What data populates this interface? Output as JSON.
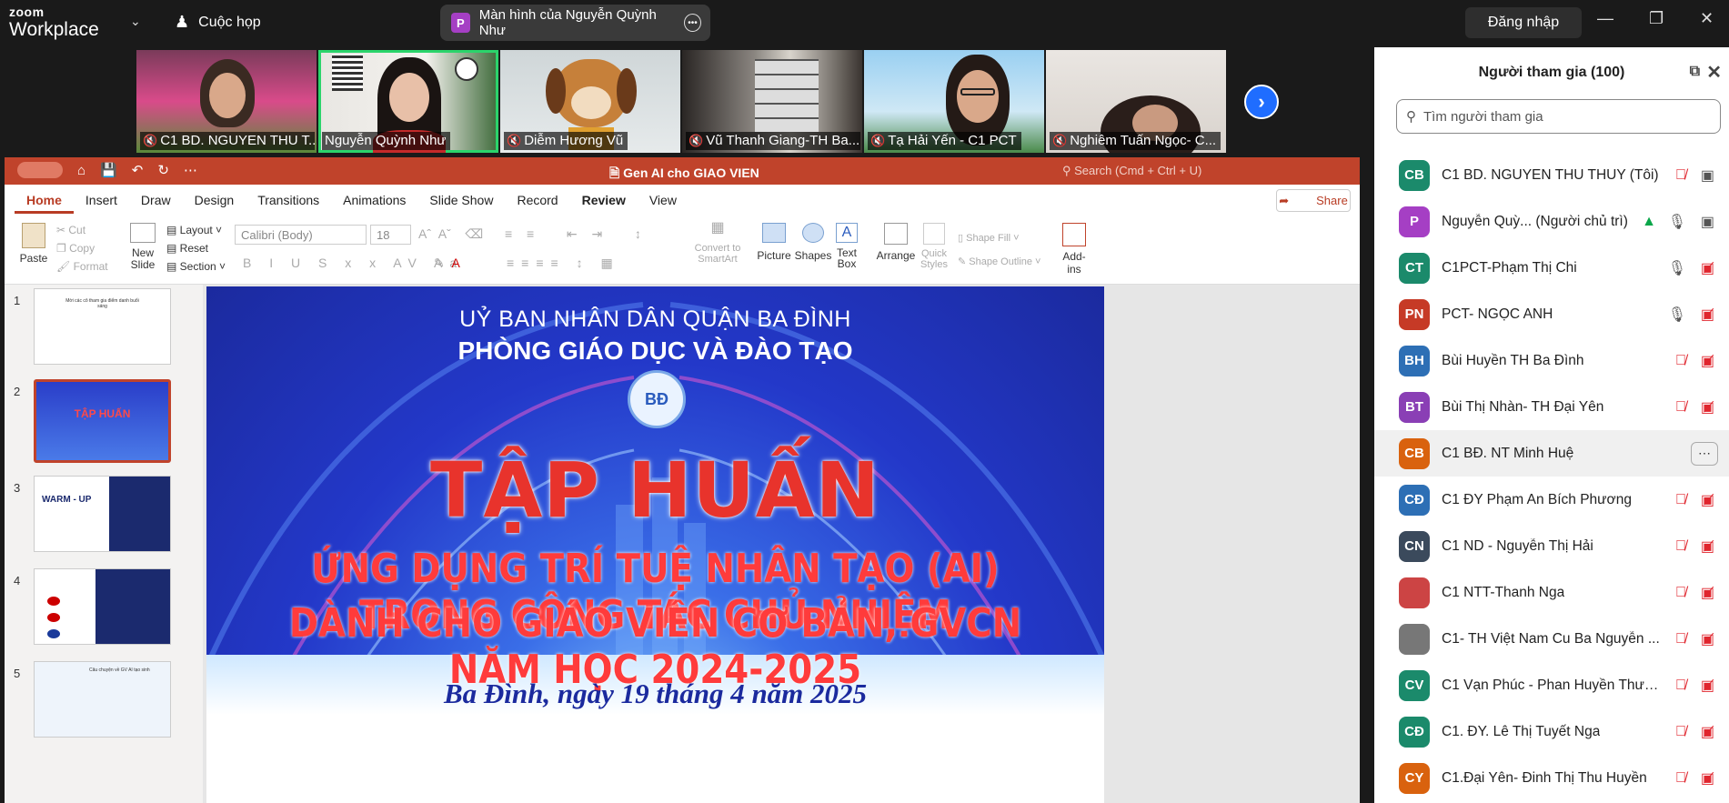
{
  "app": {
    "brand_top": "zoom",
    "brand_bottom": "Workplace"
  },
  "topbar": {
    "meeting_label": "Cuộc họp",
    "share_avatar": "P",
    "share_label": "Màn hình của Nguyễn Quỳnh Như",
    "signin_label": "Đăng nhập"
  },
  "videos": [
    {
      "name": "C1 BD. NGUYEN THU T...",
      "muted": true
    },
    {
      "name": "Nguyễn Quỳnh Như",
      "muted": false
    },
    {
      "name": "Diễm Hương Vũ",
      "muted": true
    },
    {
      "name": "Vũ Thanh Giang-TH Ba...",
      "muted": true
    },
    {
      "name": "Tạ Hải Yến - C1 PCT",
      "muted": true
    },
    {
      "name": "Nghiêm Tuấn Ngọc- C...",
      "muted": true
    }
  ],
  "ppt": {
    "doc_title": "Gen AI cho GIAO VIEN",
    "search_placeholder": "Search (Cmd + Ctrl + U)",
    "tabs": [
      "Home",
      "Insert",
      "Draw",
      "Design",
      "Transitions",
      "Animations",
      "Slide Show",
      "Record",
      "Review",
      "View"
    ],
    "share_label": "Share",
    "ribbon": {
      "paste": "Paste",
      "cut": "Cut",
      "copy": "Copy",
      "format": "Format",
      "new_slide_1": "New",
      "new_slide_2": "Slide",
      "layout": "Layout",
      "reset": "Reset",
      "section": "Section",
      "font": "Calibri (Body)",
      "size": "18",
      "convert_1": "Convert to",
      "convert_2": "SmartArt",
      "picture": "Picture",
      "shapes": "Shapes",
      "textbox_1": "Text",
      "textbox_2": "Box",
      "arrange": "Arrange",
      "quick_1": "Quick",
      "quick_2": "Styles",
      "shape_fill": "Shape Fill",
      "shape_outline": "Shape Outline",
      "addins": "Add-ins"
    },
    "thumbnails": [
      {
        "num": "1",
        "caption": "Mời các cô tham gia điểm danh buổi sáng"
      },
      {
        "num": "2",
        "caption": "TẬP HUẤN"
      },
      {
        "num": "3",
        "caption": "WARM - UP"
      },
      {
        "num": "4",
        "caption": ""
      },
      {
        "num": "5",
        "caption": "Câu chuyện về GV AI tạo sinh"
      }
    ],
    "slide": {
      "line1": "UỶ BAN NHÂN DÂN QUẬN BA ĐÌNH",
      "line2": "PHÒNG GIÁO DỤC VÀ ĐÀO TẠO",
      "seal": "BĐ",
      "title": "TẬP HUẤN",
      "sub1": "ỨNG DỤNG TRÍ TUỆ NHÂN TẠO (AI) TRONG CÔNG TÁC CHỦ NHIỆM",
      "sub2": "DÀNH CHO GIÁO VIÊN CƠ BẢN, GVCN NĂM HỌC 2024-2025",
      "date": "Ba Đình, ngày 19 tháng 4 năm 2025"
    }
  },
  "panel": {
    "title": "Người tham gia (100)",
    "search_placeholder": "Tìm người tham gia",
    "participants": [
      {
        "initials": "CB",
        "color": "#1b8a6b",
        "name": "C1 BD. NGUYEN THU THUY (Tôi)",
        "mic": "muted",
        "cam": "on"
      },
      {
        "initials": "P",
        "color": "#a53fc4",
        "name": "Nguyễn Quỳ... (Người chủ trì)",
        "mic": "on",
        "cam": "on"
      },
      {
        "initials": "CT",
        "color": "#1b8a6b",
        "name": "C1PCT-Phạm Thị Chi",
        "mic": "on",
        "cam": "off"
      },
      {
        "initials": "PN",
        "color": "#c63a26",
        "name": "PCT- NGỌC ANH",
        "mic": "on",
        "cam": "off"
      },
      {
        "initials": "BH",
        "color": "#2d6fb5",
        "name": "Bùi Huyền TH Ba Đình",
        "mic": "muted",
        "cam": "off"
      },
      {
        "initials": "BT",
        "color": "#8a3fb5",
        "name": "Bùi Thị Nhàn- TH Đại Yên",
        "mic": "muted",
        "cam": "off"
      },
      {
        "initials": "CB",
        "color": "#d9620e",
        "name": "C1 BĐ. NT Minh Huệ",
        "mic": "more",
        "cam": ""
      },
      {
        "initials": "CĐ",
        "color": "#2d6fb5",
        "name": "C1 ĐY Phạm An Bích Phương",
        "mic": "muted",
        "cam": "off"
      },
      {
        "initials": "CN",
        "color": "#3b4a5c",
        "name": "C1 ND - Nguyễn Thị Hải",
        "mic": "muted",
        "cam": "off"
      },
      {
        "initials": "",
        "color": "#cc4444",
        "name": "C1 NTT-Thanh Nga",
        "mic": "muted",
        "cam": "off"
      },
      {
        "initials": "",
        "color": "#777777",
        "name": "C1- TH Việt Nam Cu Ba Nguyễn ...",
        "mic": "muted",
        "cam": "off"
      },
      {
        "initials": "CV",
        "color": "#1b8a6b",
        "name": "C1 Vạn Phúc - Phan Huyền Thươ...",
        "mic": "muted",
        "cam": "off"
      },
      {
        "initials": "CĐ",
        "color": "#1b8a6b",
        "name": "C1. ĐY. Lê Thị Tuyết Nga",
        "mic": "muted",
        "cam": "off"
      },
      {
        "initials": "CY",
        "color": "#d9620e",
        "name": "C1.Đại Yên- Đinh Thị Thu Huyền",
        "mic": "muted",
        "cam": "off"
      }
    ]
  }
}
